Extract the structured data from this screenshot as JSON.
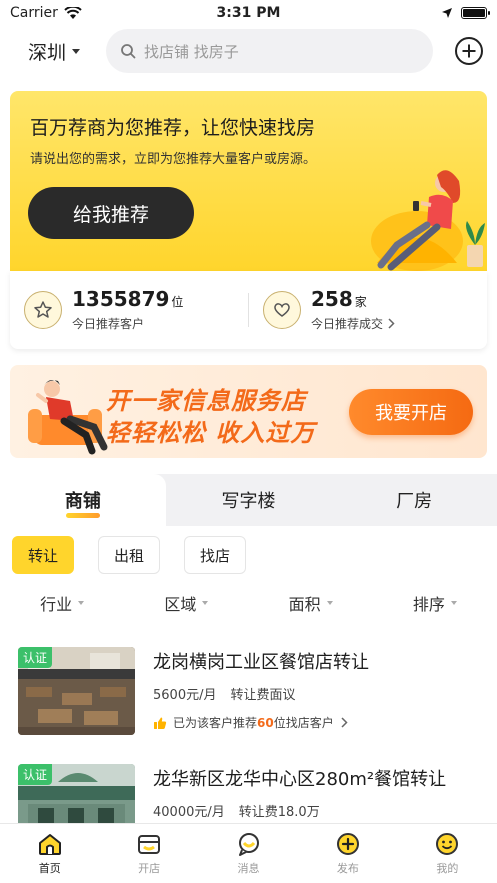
{
  "status_bar": {
    "carrier": "Carrier",
    "time": "3:31 PM",
    "battery_level": 1.0
  },
  "top_bar": {
    "city": "深圳",
    "search_placeholder": "找店铺 找房子"
  },
  "banner": {
    "title": "百万荐商为您推荐，让您快速找房",
    "subtitle": "请说出您的需求，立即为您推荐大量客户或房源。",
    "button": "给我推荐"
  },
  "stats": [
    {
      "number": "1355879",
      "unit": "位",
      "label": "今日推荐客户",
      "icon": "star-icon"
    },
    {
      "number": "258",
      "unit": "家",
      "label": "今日推荐成交",
      "icon": "heart-icon"
    }
  ],
  "promo": {
    "line1": "开一家信息服务店",
    "line2": "轻轻松松  收入过万",
    "button": "我要开店"
  },
  "tabs": [
    {
      "label": "商铺",
      "active": true
    },
    {
      "label": "写字楼",
      "active": false
    },
    {
      "label": "厂房",
      "active": false
    }
  ],
  "chips": [
    {
      "label": "转让",
      "active": true
    },
    {
      "label": "出租",
      "active": false
    },
    {
      "label": "找店",
      "active": false
    }
  ],
  "filters": [
    "行业",
    "区域",
    "面积",
    "排序"
  ],
  "listings": [
    {
      "badge": "认证",
      "title": "龙岗横岗工业区餐馆店转让",
      "price": "5600元/月",
      "fee": "转让费面议",
      "reco_prefix": "已为该客户推荐",
      "reco_count": "60",
      "reco_suffix": "位找店客户"
    },
    {
      "badge": "认证",
      "title": "龙华新区龙华中心区280m²餐馆转让",
      "price": "40000元/月",
      "fee": "转让费18.0万"
    }
  ],
  "bottom_nav": [
    {
      "label": "首页",
      "icon": "home-icon",
      "active": true
    },
    {
      "label": "开店",
      "icon": "store-icon",
      "active": false
    },
    {
      "label": "消息",
      "icon": "message-icon",
      "active": false
    },
    {
      "label": "发布",
      "icon": "publish-icon",
      "active": false
    },
    {
      "label": "我的",
      "icon": "profile-icon",
      "active": false
    }
  ],
  "colors": {
    "accent_yellow": "#ffd52c",
    "accent_orange": "#f36a1a",
    "verified_green": "#3cc06a"
  }
}
